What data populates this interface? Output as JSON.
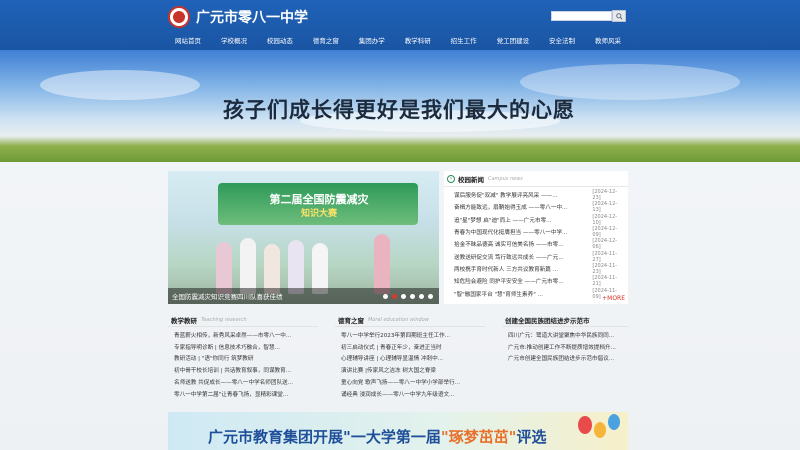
{
  "header": {
    "site_title": "广元市零八一中学",
    "logo_icon": "school-seal-icon",
    "search": {
      "placeholder": "",
      "button_icon": "search-icon"
    },
    "nav": [
      "网站首页",
      "学校概况",
      "校园动态",
      "德育之窗",
      "集团办学",
      "教学科研",
      "招生工作",
      "党工团建设",
      "安全法制",
      "教师风采"
    ]
  },
  "banner": {
    "slogan": "孩子们成长得更好是我们最大的心愿"
  },
  "slideshow": {
    "caption": "全国防震减灾知识竞赛四川队喜获佳绩",
    "stage_title": "第二届全国防震减灾",
    "stage_subtitle": "知识大赛",
    "dot_count": 6,
    "active_dot": 2
  },
  "campus_news": {
    "title": "校园新闻",
    "subtitle": "Campus news",
    "more": "+MORE",
    "items": [
      {
        "text": "谋后服务促\"双减\" 教学展评亮风采 ——...",
        "date": "[2024-12-23]"
      },
      {
        "text": "奋楫方能致远，扇鞘始得玉成 ——零八一中...",
        "date": "[2024-12-13]"
      },
      {
        "text": "追\"星\"梦想 启\"迪\"而上 ——广元市零...",
        "date": "[2024-12-10]"
      },
      {
        "text": "青春为中国现代化挺膺担当 ——零八一中学...",
        "date": "[2024-12-09]"
      },
      {
        "text": "拾金不昧品德高 诚实可信美名扬 ——市零...",
        "date": "[2024-12-06]"
      },
      {
        "text": "送教送研促交流 笃行致远共成长 ——广元...",
        "date": "[2024-11-27]"
      },
      {
        "text": "两校携手育时代新人 三方共议教育新篇 ...",
        "date": "[2024-11-23]"
      },
      {
        "text": "知危险会避险 同护平安安全 ——广元市零...",
        "date": "[2024-11-21]"
      },
      {
        "text": "\"智\"融国家平台 \"慧\"育师生素养\" ...",
        "date": "[2024-11-09]"
      }
    ]
  },
  "columns": [
    {
      "title": "教学教研",
      "subtitle": "Teaching research",
      "items": [
        "青蓝薪火相传，新秀风采卓然——市零八一中...",
        "专家指导明诊断 | 信息技术巧融合，智慧...",
        "教研活动 | \"语\"你同行 筑梦教研",
        "初中骨干校长培训 | 共话教育叙事，同谋教育...",
        "名师送教 共促成长——零八一中学名师团队送...",
        "零八一中学第二届\"让青春飞扬，显精彩课堂..."
      ]
    },
    {
      "title": "德育之窗",
      "subtitle": "Moral education window",
      "items": [
        "零八一中学举行2023年第四期班主任工作...",
        "初三启动仪式 | 青春正年少，奋进正当时",
        "心理辅导讲座 | 心理辅导显温情 冲刺中...",
        "演讲比赛 |传家风之洁冻 树大国之脊梁",
        "童心向党 歌声飞扬——零八一中学小学部举行...",
        "诵经典 浸润成长——零八一中学九年级语文..."
      ]
    },
    {
      "title": "创建全国民族团结进步示范市",
      "subtitle": "",
      "items": [
        "四川广元：鹭道大讲堂聚焦中华民族同同...",
        "广元市:推动创建工作不断提质增效提档升...",
        "广元市创建全国民族团结进步示范市倡议..."
      ]
    }
  ],
  "bottom_banner": {
    "text_main": "广元市教育集团开展\"一大学第一届",
    "text_highlight": "\"琢梦茁茁\"",
    "text_tail": "评选"
  },
  "colors": {
    "header_blue": "#1f62b8",
    "accent_red": "#d92e25",
    "icon_green": "#2e8b57"
  }
}
